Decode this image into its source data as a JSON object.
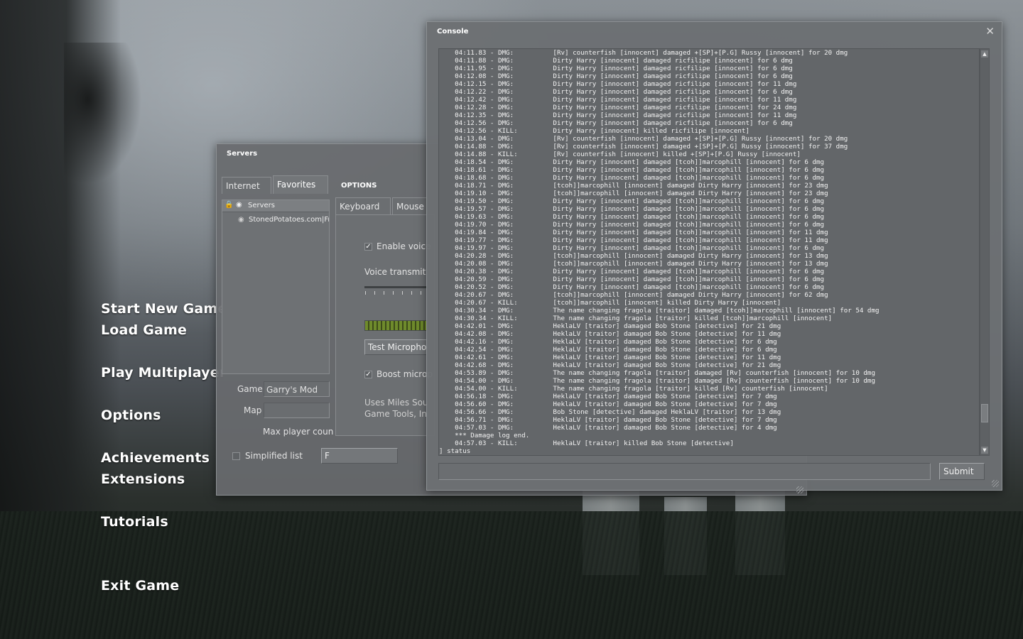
{
  "main_menu": [
    "Start New Game",
    "Load Game",
    "Play Multiplayer",
    "Options",
    "Achievements",
    "Extensions",
    "Tutorials",
    "Exit Game"
  ],
  "servers_window": {
    "title": "Servers",
    "tabs": [
      "Internet",
      "Favorites"
    ],
    "list_header": "Servers",
    "server_row": "StonedPotatoes.com|Fre",
    "game_label": "Game",
    "game_value": "Garry's Mod",
    "map_label": "Map",
    "map_value": "",
    "max_player_label": "Max player coun",
    "simplified_list_label": "Simplified list",
    "bottom_button": "F"
  },
  "options_window": {
    "title": "OPTIONS",
    "tabs": [
      "Keyboard",
      "Mouse"
    ],
    "enable_voice_label": "Enable voice",
    "voice_transmit_label": "Voice transmit",
    "test_mic_button": "Test Microphon",
    "boost_mic_label": "Boost microp",
    "info_line_1": "Uses Miles Sou",
    "info_line_2": "Game Tools, In"
  },
  "console_window": {
    "title": "Console",
    "close_icon": "✕",
    "submit_label": "Submit",
    "input_value": "",
    "lines": [
      "    04:11.83 - DMG:          [Rv] counterfish [innocent] damaged +[SP]+[P.G] Russy [innocent] for 20 dmg",
      "    04:11.88 - DMG:          Dirty Harry [innocent] damaged ricfilipe [innocent] for 6 dmg",
      "    04:11.95 - DMG:          Dirty Harry [innocent] damaged ricfilipe [innocent] for 6 dmg",
      "    04:12.08 - DMG:          Dirty Harry [innocent] damaged ricfilipe [innocent] for 6 dmg",
      "    04:12.15 - DMG:          Dirty Harry [innocent] damaged ricfilipe [innocent] for 11 dmg",
      "    04:12.22 - DMG:          Dirty Harry [innocent] damaged ricfilipe [innocent] for 6 dmg",
      "    04:12.42 - DMG:          Dirty Harry [innocent] damaged ricfilipe [innocent] for 11 dmg",
      "    04:12.28 - DMG:          Dirty Harry [innocent] damaged ricfilipe [innocent] for 24 dmg",
      "    04:12.35 - DMG:          Dirty Harry [innocent] damaged ricfilipe [innocent] for 11 dmg",
      "    04:12.56 - DMG:          Dirty Harry [innocent] damaged ricfilipe [innocent] for 6 dmg",
      "    04:12.56 - KILL:         Dirty Harry [innocent] killed ricfilipe [innocent]",
      "    04:13.04 - DMG:          [Rv] counterfish [innocent] damaged +[SP]+[P.G] Russy [innocent] for 20 dmg",
      "    04:14.88 - DMG:          [Rv] counterfish [innocent] damaged +[SP]+[P.G] Russy [innocent] for 37 dmg",
      "    04:14.88 - KILL:         [Rv] counterfish [innocent] killed +[SP]+[P.G] Russy [innocent]",
      "    04:18.54 - DMG:          Dirty Harry [innocent] damaged [tcoh]]marcophill [innocent] for 6 dmg",
      "    04:18.61 - DMG:          Dirty Harry [innocent] damaged [tcoh]]marcophill [innocent] for 6 dmg",
      "    04:18.68 - DMG:          Dirty Harry [innocent] damaged [tcoh]]marcophill [innocent] for 6 dmg",
      "    04:18.71 - DMG:          [tcoh]]marcophill [innocent] damaged Dirty Harry [innocent] for 23 dmg",
      "    04:19.10 - DMG:          [tcoh]]marcophill [innocent] damaged Dirty Harry [innocent] for 23 dmg",
      "    04:19.50 - DMG:          Dirty Harry [innocent] damaged [tcoh]]marcophill [innocent] for 6 dmg",
      "    04:19.57 - DMG:          Dirty Harry [innocent] damaged [tcoh]]marcophill [innocent] for 6 dmg",
      "    04:19.63 - DMG:          Dirty Harry [innocent] damaged [tcoh]]marcophill [innocent] for 6 dmg",
      "    04:19.70 - DMG:          Dirty Harry [innocent] damaged [tcoh]]marcophill [innocent] for 6 dmg",
      "    04:19.84 - DMG:          Dirty Harry [innocent] damaged [tcoh]]marcophill [innocent] for 11 dmg",
      "    04:19.77 - DMG:          Dirty Harry [innocent] damaged [tcoh]]marcophill [innocent] for 11 dmg",
      "    04:19.97 - DMG:          Dirty Harry [innocent] damaged [tcoh]]marcophill [innocent] for 6 dmg",
      "    04:20.28 - DMG:          [tcoh]]marcophill [innocent] damaged Dirty Harry [innocent] for 13 dmg",
      "    04:20.08 - DMG:          [tcoh]]marcophill [innocent] damaged Dirty Harry [innocent] for 13 dmg",
      "    04:20.38 - DMG:          Dirty Harry [innocent] damaged [tcoh]]marcophill [innocent] for 6 dmg",
      "    04:20.59 - DMG:          Dirty Harry [innocent] damaged [tcoh]]marcophill [innocent] for 6 dmg",
      "    04:20.52 - DMG:          Dirty Harry [innocent] damaged [tcoh]]marcophill [innocent] for 6 dmg",
      "    04:20.67 - DMG:          [tcoh]]marcophill [innocent] damaged Dirty Harry [innocent] for 62 dmg",
      "    04:20.67 - KILL:         [tcoh]]marcophill [innocent] killed Dirty Harry [innocent]",
      "    04:30.34 - DMG:          The name changing fragola [traitor] damaged [tcoh]]marcophill [innocent] for 54 dmg",
      "    04:30.34 - KILL:         The name changing fragola [traitor] killed [tcoh]]marcophill [innocent]",
      "    04:42.01 - DMG:          HeklaLV [traitor] damaged Bob Stone [detective] for 21 dmg",
      "    04:42.08 - DMG:          HeklaLV [traitor] damaged Bob Stone [detective] for 11 dmg",
      "    04:42.16 - DMG:          HeklaLV [traitor] damaged Bob Stone [detective] for 6 dmg",
      "    04:42.54 - DMG:          HeklaLV [traitor] damaged Bob Stone [detective] for 6 dmg",
      "    04:42.61 - DMG:          HeklaLV [traitor] damaged Bob Stone [detective] for 11 dmg",
      "    04:42.68 - DMG:          HeklaLV [traitor] damaged Bob Stone [detective] for 21 dmg",
      "    04:53.89 - DMG:          The name changing fragola [traitor] damaged [Rv] counterfish [innocent] for 10 dmg",
      "    04:54.00 - DMG:          The name changing fragola [traitor] damaged [Rv] counterfish [innocent] for 10 dmg",
      "    04:54.00 - KILL:         The name changing fragola [traitor] killed [Rv] counterfish [innocent]",
      "    04:56.18 - DMG:          HeklaLV [traitor] damaged Bob Stone [detective] for 7 dmg",
      "    04:56.60 - DMG:          HeklaLV [traitor] damaged Bob Stone [detective] for 7 dmg",
      "    04:56.66 - DMG:          Bob Stone [detective] damaged HeklaLV [traitor] for 13 dmg",
      "    04:56.71 - DMG:          HeklaLV [traitor] damaged Bob Stone [detective] for 7 dmg",
      "    04:57.03 - DMG:          HeklaLV [traitor] damaged Bob Stone [detective] for 4 dmg",
      "    *** Damage log end.",
      "    04:57.03 - KILL:         HeklaLV [traitor] killed Bob Stone [detective]",
      "] status"
    ]
  }
}
